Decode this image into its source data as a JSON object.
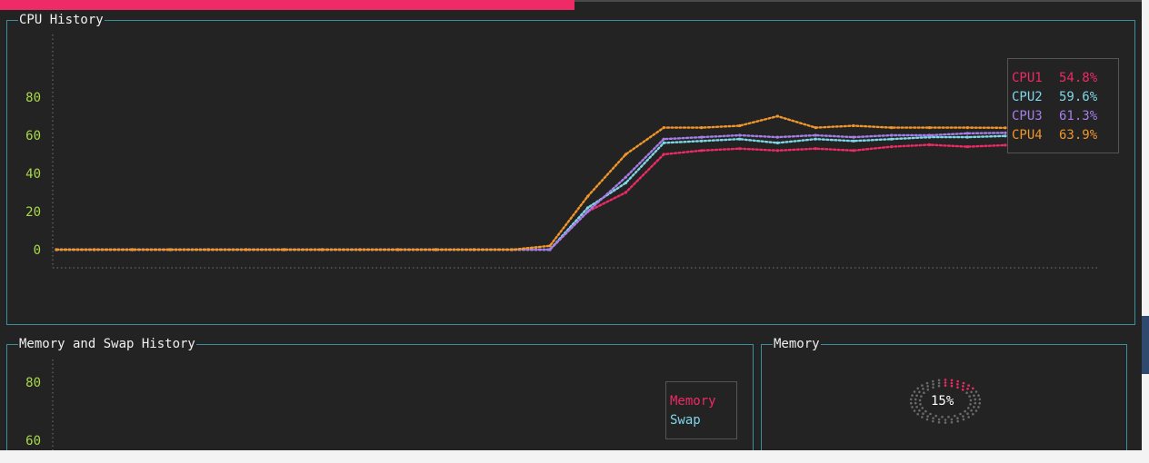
{
  "colors": {
    "background": "#232323",
    "panel_border": "#3a8f9e",
    "axis_label": "#a8d84a",
    "progress_fill": "#ee2a67",
    "cpu1": "#ee2a67",
    "cpu2": "#7fd6e8",
    "cpu3": "#a57fe8",
    "cpu4": "#f0962a",
    "memory": "#ee2a67",
    "swap": "#7fd6e8"
  },
  "top_progress": {
    "value_fraction": 0.5
  },
  "cpu_history": {
    "title": "CPU History",
    "legend": [
      {
        "label": "CPU1",
        "value": "54.8%",
        "color_key": "cpu1"
      },
      {
        "label": "CPU2",
        "value": "59.6%",
        "color_key": "cpu2"
      },
      {
        "label": "CPU3",
        "value": "61.3%",
        "color_key": "cpu3"
      },
      {
        "label": "CPU4",
        "value": "63.9%",
        "color_key": "cpu4"
      }
    ]
  },
  "memory_swap_history": {
    "title": "Memory and Swap History",
    "legend": [
      {
        "label": "Memory",
        "color_key": "memory"
      },
      {
        "label": "Swap",
        "color_key": "swap"
      }
    ]
  },
  "memory_gauge": {
    "title": "Memory",
    "percent_label": "15%",
    "value_fraction": 0.15
  },
  "chart_data": [
    {
      "type": "line",
      "title": "CPU History",
      "xlabel": "",
      "ylabel": "",
      "ylim": [
        0,
        100
      ],
      "y_ticks": [
        "80",
        "60",
        "40",
        "20",
        "0"
      ],
      "grid": false,
      "legend_position": "top-right",
      "x": [
        0,
        4,
        8,
        12,
        16,
        20,
        24,
        28,
        32,
        36,
        40,
        44,
        48,
        52,
        56,
        60,
        64,
        68,
        72,
        76,
        80,
        84,
        88,
        92,
        96,
        100
      ],
      "series": [
        {
          "name": "CPU1",
          "values": [
            0,
            0,
            0,
            0,
            0,
            0,
            0,
            0,
            0,
            0,
            0,
            0,
            0,
            0,
            20,
            30,
            50,
            52,
            53,
            52,
            53,
            52,
            54,
            55,
            54,
            54.8
          ]
        },
        {
          "name": "CPU2",
          "values": [
            0,
            0,
            0,
            0,
            0,
            0,
            0,
            0,
            0,
            0,
            0,
            0,
            0,
            0,
            22,
            35,
            56,
            57,
            58,
            56,
            58,
            57,
            58,
            59,
            59,
            59.6
          ]
        },
        {
          "name": "CPU3",
          "values": [
            0,
            0,
            0,
            0,
            0,
            0,
            0,
            0,
            0,
            0,
            0,
            0,
            0,
            0,
            20,
            38,
            58,
            59,
            60,
            59,
            60,
            59,
            60,
            60,
            61,
            61.3
          ]
        },
        {
          "name": "CPU4",
          "values": [
            0,
            0,
            0,
            0,
            0,
            0,
            0,
            0,
            0,
            0,
            0,
            0,
            0,
            2,
            28,
            50,
            64,
            64,
            65,
            70,
            64,
            65,
            64,
            64,
            64,
            63.9
          ]
        }
      ]
    },
    {
      "type": "line",
      "title": "Memory and Swap History",
      "xlabel": "",
      "ylabel": "",
      "ylim": [
        0,
        100
      ],
      "y_ticks": [
        "80",
        "60"
      ],
      "grid": false,
      "legend_position": "top-right",
      "series": [
        {
          "name": "Memory",
          "values": []
        },
        {
          "name": "Swap",
          "values": []
        }
      ]
    }
  ]
}
